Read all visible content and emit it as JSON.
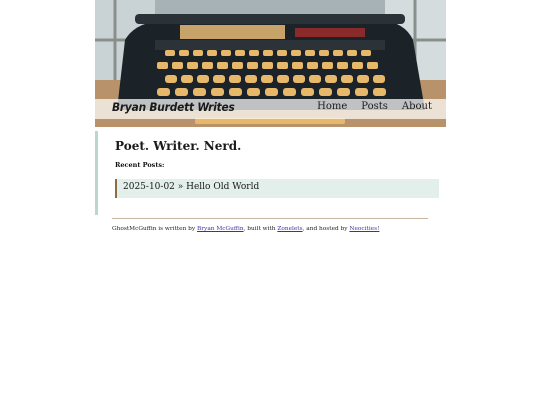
{
  "header": {
    "site_title": "Bryan Burdett Writes",
    "nav": [
      {
        "label": "Home"
      },
      {
        "label": "Posts"
      },
      {
        "label": "About"
      }
    ]
  },
  "main": {
    "tagline": "Poet. Writer. Nerd.",
    "recent_heading": "Recent Posts:",
    "posts": [
      {
        "label": "2025-10-02 » Hello Old World"
      }
    ]
  },
  "footer": {
    "t1": "GhostMcGuffin is written by ",
    "author_link": "Bryan McGuffin",
    "t2": ", built with ",
    "zonelets_link": "Zonelets",
    "t3": ", and hosted by ",
    "neocities_link": "Neocities!"
  },
  "colors": {
    "content_border": "#b9d7cf",
    "post_bg": "#e2efea",
    "post_border": "#8a6d44",
    "link": "#4030a0"
  }
}
